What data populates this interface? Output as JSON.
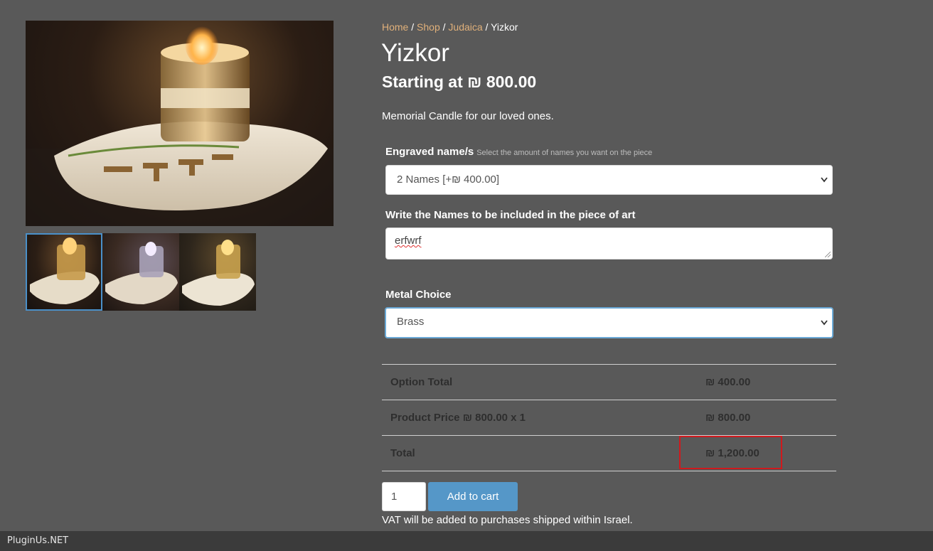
{
  "breadcrumb": {
    "items": [
      "Home",
      "Shop",
      "Judaica"
    ],
    "separator": " / ",
    "current": "Yizkor"
  },
  "product": {
    "title": "Yizkor",
    "price_line": "Starting at ₪ 800.00",
    "short_description": "Memorial Candle for our loved ones."
  },
  "gallery": {
    "main_image": "yizkor-candle-brass",
    "thumbnails": [
      "yizkor-candle-brass",
      "yizkor-candle-silver",
      "yizkor-candle-gold"
    ],
    "active_thumbnail": 0,
    "engraving_text": "יזכור"
  },
  "options": {
    "engraved_names": {
      "label": "Engraved name/s",
      "hint": "Select the amount of names you want on the piece",
      "selected": "2 Names [+₪ 400.00]"
    },
    "names_text": {
      "label": "Write the Names to be included in the piece of art",
      "value": "erfwrf"
    },
    "metal_choice": {
      "label": "Metal Choice",
      "selected": "Brass"
    }
  },
  "totals": {
    "rows": [
      {
        "label": "Option Total",
        "value": "₪ 400.00"
      },
      {
        "label": "Product Price ₪ 800.00 x 1",
        "value": "₪ 800.00"
      },
      {
        "label": "Total",
        "value": "₪ 1,200.00"
      }
    ]
  },
  "cart": {
    "quantity": "1",
    "add_to_cart_label": "Add to cart",
    "vat_note": "VAT will be added to purchases shipped within Israel."
  },
  "footer": {
    "brand": "PluginUs.NET"
  },
  "colors": {
    "background": "#595959",
    "link": "#e0b07a",
    "button": "#5597c8",
    "highlight": "#d0191d",
    "focus": "#6aa9d6"
  },
  "icons": {
    "select_chevron": "chevron-down-icon"
  }
}
